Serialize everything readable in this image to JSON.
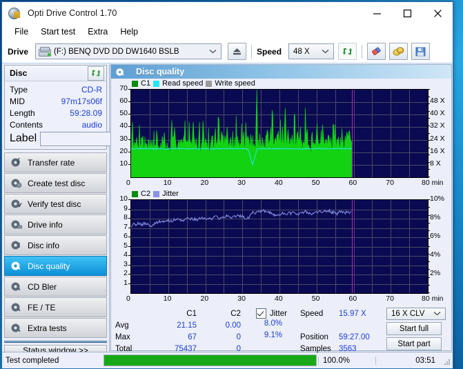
{
  "window": {
    "title": "Opti Drive Control 1.70",
    "app_icon": "disc-icon",
    "minimize": "minimize-icon",
    "maximize": "maximize-icon",
    "close": "close-icon"
  },
  "menu": {
    "items": [
      "File",
      "Start test",
      "Extra",
      "Help"
    ]
  },
  "toolbar": {
    "drive_label": "Drive",
    "drive_value": "(F:)  BENQ DVD DD DW1640 BSLB",
    "eject_icon": "eject-icon",
    "speed_label": "Speed",
    "speed_value": "48 X",
    "refresh_icon": "refresh-icon",
    "erase_icon": "eraser-icon",
    "bitsetting_icon": "gold-coins-icon",
    "save_icon": "floppy-save-icon"
  },
  "sidebar": {
    "disc_panel": {
      "title": "Disc",
      "refresh_icon": "refresh-icon",
      "rows": [
        {
          "key": "Type",
          "value": "CD-R"
        },
        {
          "key": "MID",
          "value": "97m17s06f"
        },
        {
          "key": "Length",
          "value": "59:28.09"
        },
        {
          "key": "Contents",
          "value": "audio"
        }
      ],
      "label_key": "Label",
      "label_value": "",
      "label_placeholder": "",
      "disc_icon": "cd-disc-icon"
    },
    "nav_items": [
      {
        "label": "Transfer rate",
        "icon": "disc-transfer-icon",
        "active": false
      },
      {
        "label": "Create test disc",
        "icon": "disc-create-icon",
        "active": false
      },
      {
        "label": "Verify test disc",
        "icon": "disc-verify-icon",
        "active": false
      },
      {
        "label": "Drive info",
        "icon": "disc-drive-icon",
        "active": false
      },
      {
        "label": "Disc info",
        "icon": "disc-info-icon",
        "active": false
      },
      {
        "label": "Disc quality",
        "icon": "disc-quality-icon",
        "active": true
      },
      {
        "label": "CD Bler",
        "icon": "disc-bler-icon",
        "active": false
      },
      {
        "label": "FE / TE",
        "icon": "disc-fete-icon",
        "active": false
      },
      {
        "label": "Extra tests",
        "icon": "disc-extra-icon",
        "active": false
      }
    ],
    "status_window_button": "Status window >>"
  },
  "main": {
    "header_title": "Disc quality",
    "header_icon": "disc-quality-icon"
  },
  "chart_data": [
    {
      "type": "area",
      "name": "c1-chart",
      "title": "",
      "legend": [
        {
          "label": "C1",
          "color": "#0a8c0a"
        },
        {
          "label": "Read speed",
          "color": "#24e8f0"
        },
        {
          "label": "Write speed",
          "color": "#9a9a9a"
        }
      ],
      "legend_position": "top-left",
      "xlabel": "min",
      "ylabel": "",
      "xlim": [
        0,
        80
      ],
      "xticks": [
        0,
        10,
        20,
        30,
        40,
        50,
        60,
        70,
        80
      ],
      "ylim": [
        0,
        70
      ],
      "yticks": [
        10,
        20,
        30,
        40,
        50,
        60,
        70
      ],
      "y2label": "X",
      "y2lim": [
        0,
        56
      ],
      "y2ticks": [
        "8 X",
        "16 X",
        "24 X",
        "32 X",
        "40 X",
        "48 X"
      ],
      "grid": true,
      "data_end_x": 59.45,
      "cursor_x": 59.45,
      "series": [
        {
          "name": "C1",
          "color": "#12d212",
          "type": "area",
          "x_start": 0,
          "x_end": 59.45,
          "values": [
            15,
            47,
            26,
            22,
            31,
            21,
            30,
            24,
            19,
            41,
            23,
            26,
            28,
            25,
            21,
            37,
            24,
            30,
            20,
            28,
            22,
            31,
            24,
            27,
            19,
            35,
            23,
            26,
            43,
            25,
            30,
            22,
            27,
            21,
            34,
            25,
            29,
            19,
            24,
            33,
            23,
            30,
            21,
            26,
            58,
            35,
            24,
            40,
            28,
            23,
            27,
            30,
            22,
            34,
            25,
            29,
            21,
            26,
            46,
            24,
            31,
            27,
            20,
            35,
            23,
            28,
            24,
            57,
            30,
            22,
            26,
            31,
            25,
            20,
            37,
            24,
            29,
            22,
            44,
            27,
            23,
            31,
            26,
            20,
            35,
            22,
            28,
            24,
            33,
            27,
            21,
            38,
            25,
            29,
            23,
            61,
            31,
            24,
            28,
            35,
            22,
            30,
            26,
            21,
            53,
            27,
            31,
            24,
            29,
            23,
            35,
            26,
            30,
            20,
            44,
            25,
            29,
            33,
            22,
            27,
            36,
            24,
            31,
            20,
            42,
            28,
            25,
            33,
            23,
            30,
            26,
            21,
            38,
            24,
            29,
            22,
            67,
            31,
            27,
            24,
            35,
            21,
            29,
            26,
            32,
            23,
            30,
            25,
            46,
            28,
            22,
            34,
            27,
            59,
            31,
            24,
            29,
            23,
            36,
            26,
            30,
            21,
            41,
            25,
            33,
            28,
            22,
            52,
            30,
            26,
            35,
            23,
            29,
            24,
            31,
            27,
            21,
            55,
            28,
            33,
            25,
            30,
            22,
            36,
            27,
            31,
            24,
            29,
            21,
            48,
            26,
            34,
            23,
            30,
            27,
            22,
            36,
            25,
            31,
            28,
            24,
            43,
            29,
            26,
            33,
            22,
            30,
            25,
            38,
            27,
            31,
            23,
            29,
            26,
            35,
            24,
            30,
            28,
            22,
            44,
            27,
            32,
            25,
            29,
            23,
            36,
            26,
            31,
            24,
            40,
            28,
            22,
            34,
            27,
            30,
            25,
            29,
            38,
            26,
            32
          ]
        },
        {
          "name": "Read speed",
          "color": "#24e8f0",
          "type": "line",
          "x_start": 0,
          "x_end": 59.45,
          "note": "flat CLV near 16 X with a dip at 28.6 min",
          "values": [
            22.6,
            22.8,
            22.7,
            22.9,
            22.8,
            22.7,
            22.9,
            22.8,
            22.7,
            22.9,
            22.8,
            22.9,
            22.7,
            22.8,
            22.9,
            22.8,
            22.7,
            22.9,
            22.8,
            22.9,
            22.8,
            22.7,
            22.9,
            22.8,
            22.9,
            22.8,
            22.7,
            10.0,
            22.8,
            22.9,
            22.8,
            22.9,
            22.7,
            22.8,
            22.9,
            22.8,
            22.9,
            22.8,
            22.7,
            22.9,
            22.8,
            22.9,
            22.8,
            22.7,
            22.9,
            22.8,
            22.9,
            22.8,
            22.9,
            22.8
          ]
        }
      ]
    },
    {
      "type": "line",
      "name": "jitter-chart",
      "title": "",
      "legend": [
        {
          "label": "C2",
          "color": "#0a8c0a"
        },
        {
          "label": "Jitter",
          "color": "#8a92e8"
        }
      ],
      "legend_position": "top-left",
      "xlabel": "min",
      "ylabel": "",
      "xlim": [
        0,
        80
      ],
      "xticks": [
        0,
        10,
        20,
        30,
        40,
        50,
        60,
        70,
        80
      ],
      "ylim": [
        0,
        10
      ],
      "yticks": [
        1,
        2,
        3,
        4,
        5,
        6,
        7,
        8,
        9,
        10
      ],
      "y2label": "%",
      "y2ticks": [
        "2%",
        "4%",
        "6%",
        "8%",
        "10%"
      ],
      "grid": true,
      "data_end_x": 59.45,
      "cursor_x": 59.45,
      "series": [
        {
          "name": "Jitter",
          "color": "#8a92e8",
          "type": "line",
          "x_start": 0,
          "x_end": 59.45,
          "values": [
            7.2,
            7.4,
            7.3,
            7.5,
            7.4,
            7.3,
            7.5,
            7.4,
            7.3,
            7.2,
            7.4,
            7.5,
            7.6,
            7.7,
            7.8,
            7.7,
            7.9,
            7.8,
            7.7,
            7.9,
            7.8,
            7.9,
            7.8,
            7.7,
            7.9,
            8.0,
            7.9,
            8.0,
            7.9,
            8.0,
            7.9,
            8.0,
            8.1,
            8.0,
            7.9,
            8.1,
            8.0,
            8.1,
            8.2,
            8.1,
            8.0,
            8.2,
            8.1,
            8.3,
            8.2,
            8.1,
            8.3,
            8.2,
            8.4,
            8.3,
            8.2,
            8.1,
            8.0,
            8.2,
            8.6,
            8.7,
            8.6,
            8.8,
            8.7,
            8.9,
            8.8,
            8.6,
            8.7,
            8.5,
            8.4,
            8.3,
            8.5,
            8.4,
            8.6,
            8.5,
            8.4,
            8.6,
            8.5,
            8.7,
            8.6,
            8.5,
            8.7,
            8.6,
            8.8,
            8.7,
            8.6,
            8.5,
            8.7,
            8.6,
            8.8,
            8.7,
            8.6,
            8.8,
            8.7,
            8.9,
            8.6,
            8.7,
            8.5,
            8.6,
            8.8,
            8.7,
            8.6,
            8.8,
            8.7,
            8.9
          ]
        },
        {
          "name": "C2",
          "color": "#0a8c0a",
          "type": "area",
          "values": []
        }
      ]
    }
  ],
  "stats": {
    "headers": {
      "c1": "C1",
      "c2": "C2"
    },
    "rows": [
      {
        "label": "Avg",
        "c1": "21.15",
        "c2": "0.00"
      },
      {
        "label": "Max",
        "c1": "67",
        "c2": "0"
      },
      {
        "label": "Total",
        "c1": "75437",
        "c2": "0"
      }
    ],
    "jitter": {
      "checked": true,
      "label": "Jitter",
      "avg": "8.0%",
      "max": "9.1%"
    },
    "speed_rows": [
      {
        "label": "Speed",
        "value": "15.97 X"
      },
      {
        "label": "Position",
        "value": "59:27.00"
      },
      {
        "label": "Samples",
        "value": "3563"
      }
    ],
    "write_speed_select": "16 X CLV",
    "start_full_button": "Start full",
    "start_part_button": "Start part"
  },
  "statusbar": {
    "message": "Test completed",
    "progress_percent": 100,
    "progress_text": "100.0%",
    "elapsed": "03:51"
  },
  "colors": {
    "accent": "#1b3fd4",
    "plot_bg": "#0a0a52",
    "c1_green": "#12d212",
    "read_cyan": "#24e8f0",
    "jitter_blue": "#8a92e8",
    "cursor_magenta": "#c020c0",
    "progress_green": "#18a818",
    "active_nav": "#0d8fd6"
  }
}
